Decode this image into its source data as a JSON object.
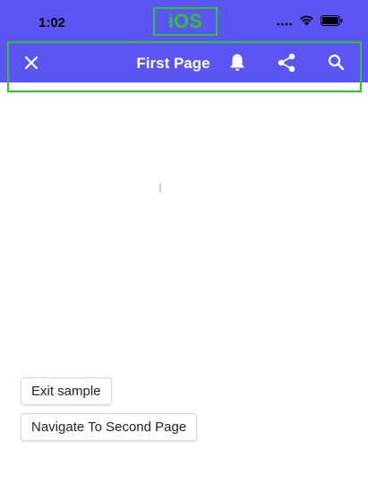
{
  "status_bar": {
    "time": "1:02",
    "platform_label": "iOS",
    "icons": [
      "signal-icon",
      "wifi-icon",
      "battery-icon"
    ]
  },
  "nav_bar": {
    "title": "First Page",
    "left_icon": "close-icon",
    "right_icons": [
      "bell-icon",
      "share-icon",
      "search-icon"
    ],
    "background": "#5b55f4",
    "highlight_color": "#2fc52f"
  },
  "buttons": {
    "exit_label": "Exit sample",
    "navigate_label": "Navigate To Second Page"
  }
}
